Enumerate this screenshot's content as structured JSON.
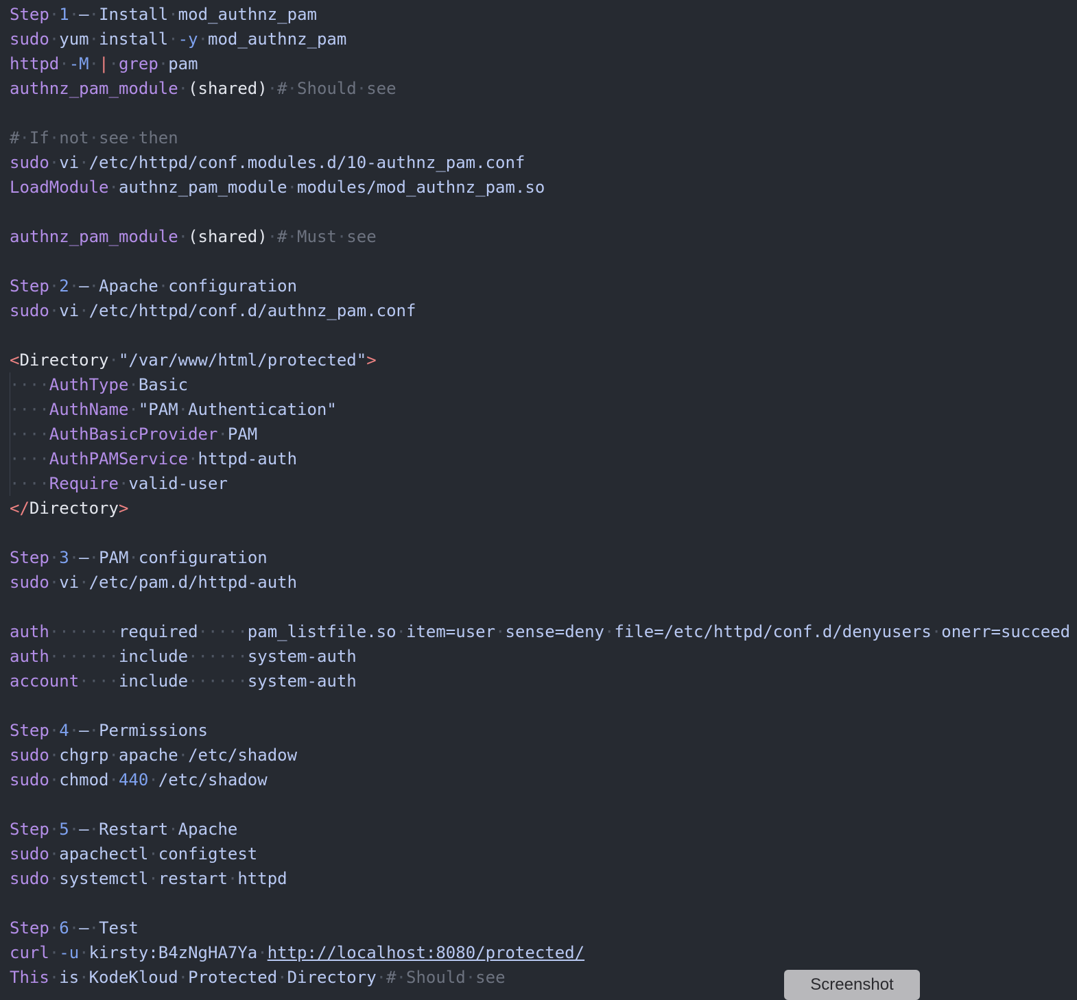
{
  "lines": [
    [
      {
        "c": "k",
        "t": "Step"
      },
      {
        "c": "ws",
        "t": "·"
      },
      {
        "c": "n",
        "t": "1"
      },
      {
        "c": "ws",
        "t": "·"
      },
      {
        "c": "p",
        "t": "—"
      },
      {
        "c": "ws",
        "t": "·"
      },
      {
        "c": "p",
        "t": "Install"
      },
      {
        "c": "ws",
        "t": "·"
      },
      {
        "c": "p",
        "t": "mod_authnz_pam"
      }
    ],
    [
      {
        "c": "k",
        "t": "sudo"
      },
      {
        "c": "ws",
        "t": "·"
      },
      {
        "c": "p",
        "t": "yum"
      },
      {
        "c": "ws",
        "t": "·"
      },
      {
        "c": "p",
        "t": "install"
      },
      {
        "c": "ws",
        "t": "·"
      },
      {
        "c": "n",
        "t": "-y"
      },
      {
        "c": "ws",
        "t": "·"
      },
      {
        "c": "p",
        "t": "mod_authnz_pam"
      }
    ],
    [
      {
        "c": "k",
        "t": "httpd"
      },
      {
        "c": "ws",
        "t": "·"
      },
      {
        "c": "n",
        "t": "-M"
      },
      {
        "c": "ws",
        "t": "·"
      },
      {
        "c": "t",
        "t": "|"
      },
      {
        "c": "ws",
        "t": "·"
      },
      {
        "c": "k",
        "t": "grep"
      },
      {
        "c": "ws",
        "t": "·"
      },
      {
        "c": "p",
        "t": "pam"
      }
    ],
    [
      {
        "c": "k",
        "t": "authnz_pam_module"
      },
      {
        "c": "ws",
        "t": "·"
      },
      {
        "c": "w",
        "t": "(shared)"
      },
      {
        "c": "ws",
        "t": "·"
      },
      {
        "c": "c",
        "t": "#"
      },
      {
        "c": "ws",
        "t": "·"
      },
      {
        "c": "c",
        "t": "Should"
      },
      {
        "c": "ws",
        "t": "·"
      },
      {
        "c": "c",
        "t": "see"
      }
    ],
    [],
    [
      {
        "c": "c",
        "t": "#"
      },
      {
        "c": "ws",
        "t": "·"
      },
      {
        "c": "c",
        "t": "If"
      },
      {
        "c": "ws",
        "t": "·"
      },
      {
        "c": "c",
        "t": "not"
      },
      {
        "c": "ws",
        "t": "·"
      },
      {
        "c": "c",
        "t": "see"
      },
      {
        "c": "ws",
        "t": "·"
      },
      {
        "c": "c",
        "t": "then"
      }
    ],
    [
      {
        "c": "k",
        "t": "sudo"
      },
      {
        "c": "ws",
        "t": "·"
      },
      {
        "c": "p",
        "t": "vi"
      },
      {
        "c": "ws",
        "t": "·"
      },
      {
        "c": "p",
        "t": "/etc/httpd/conf.modules.d/10-authnz_pam.conf"
      }
    ],
    [
      {
        "c": "k",
        "t": "LoadModule"
      },
      {
        "c": "ws",
        "t": "·"
      },
      {
        "c": "p",
        "t": "authnz_pam_module"
      },
      {
        "c": "ws",
        "t": "·"
      },
      {
        "c": "p",
        "t": "modules/mod_authnz_pam.so"
      }
    ],
    [],
    [
      {
        "c": "k",
        "t": "authnz_pam_module"
      },
      {
        "c": "ws",
        "t": "·"
      },
      {
        "c": "w",
        "t": "(shared)"
      },
      {
        "c": "ws",
        "t": "·"
      },
      {
        "c": "c",
        "t": "#"
      },
      {
        "c": "ws",
        "t": "·"
      },
      {
        "c": "c",
        "t": "Must"
      },
      {
        "c": "ws",
        "t": "·"
      },
      {
        "c": "c",
        "t": "see"
      }
    ],
    [],
    [
      {
        "c": "k",
        "t": "Step"
      },
      {
        "c": "ws",
        "t": "·"
      },
      {
        "c": "n",
        "t": "2"
      },
      {
        "c": "ws",
        "t": "·"
      },
      {
        "c": "p",
        "t": "—"
      },
      {
        "c": "ws",
        "t": "·"
      },
      {
        "c": "p",
        "t": "Apache"
      },
      {
        "c": "ws",
        "t": "·"
      },
      {
        "c": "p",
        "t": "configuration"
      }
    ],
    [
      {
        "c": "k",
        "t": "sudo"
      },
      {
        "c": "ws",
        "t": "·"
      },
      {
        "c": "p",
        "t": "vi"
      },
      {
        "c": "ws",
        "t": "·"
      },
      {
        "c": "p",
        "t": "/etc/httpd/conf.d/authnz_pam.conf"
      }
    ],
    [],
    [
      {
        "c": "t",
        "t": "<"
      },
      {
        "c": "w",
        "t": "Directory"
      },
      {
        "c": "ws",
        "t": "·"
      },
      {
        "c": "p",
        "t": "\"/var/www/html/protected\""
      },
      {
        "c": "t",
        "t": ">"
      }
    ],
    [
      {
        "c": "ws",
        "t": "····"
      },
      {
        "c": "k",
        "t": "AuthType"
      },
      {
        "c": "ws",
        "t": "·"
      },
      {
        "c": "p",
        "t": "Basic"
      }
    ],
    [
      {
        "c": "ws",
        "t": "····"
      },
      {
        "c": "k",
        "t": "AuthName"
      },
      {
        "c": "ws",
        "t": "·"
      },
      {
        "c": "p",
        "t": "\"PAM"
      },
      {
        "c": "ws",
        "t": "·"
      },
      {
        "c": "p",
        "t": "Authentication\""
      }
    ],
    [
      {
        "c": "ws",
        "t": "····"
      },
      {
        "c": "k",
        "t": "AuthBasicProvider"
      },
      {
        "c": "ws",
        "t": "·"
      },
      {
        "c": "p",
        "t": "PAM"
      }
    ],
    [
      {
        "c": "ws",
        "t": "····"
      },
      {
        "c": "k",
        "t": "AuthPAMService"
      },
      {
        "c": "ws",
        "t": "·"
      },
      {
        "c": "p",
        "t": "httpd-auth"
      }
    ],
    [
      {
        "c": "ws",
        "t": "····"
      },
      {
        "c": "k",
        "t": "Require"
      },
      {
        "c": "ws",
        "t": "·"
      },
      {
        "c": "p",
        "t": "valid-user"
      }
    ],
    [
      {
        "c": "t",
        "t": "</"
      },
      {
        "c": "w",
        "t": "Directory"
      },
      {
        "c": "t",
        "t": ">"
      }
    ],
    [],
    [
      {
        "c": "k",
        "t": "Step"
      },
      {
        "c": "ws",
        "t": "·"
      },
      {
        "c": "n",
        "t": "3"
      },
      {
        "c": "ws",
        "t": "·"
      },
      {
        "c": "p",
        "t": "—"
      },
      {
        "c": "ws",
        "t": "·"
      },
      {
        "c": "p",
        "t": "PAM"
      },
      {
        "c": "ws",
        "t": "·"
      },
      {
        "c": "p",
        "t": "configuration"
      }
    ],
    [
      {
        "c": "k",
        "t": "sudo"
      },
      {
        "c": "ws",
        "t": "·"
      },
      {
        "c": "p",
        "t": "vi"
      },
      {
        "c": "ws",
        "t": "·"
      },
      {
        "c": "p",
        "t": "/etc/pam.d/httpd-auth"
      }
    ],
    [],
    [
      {
        "c": "k",
        "t": "auth"
      },
      {
        "c": "ws",
        "t": "·······"
      },
      {
        "c": "p",
        "t": "required"
      },
      {
        "c": "ws",
        "t": "·····"
      },
      {
        "c": "p",
        "t": "pam_listfile.so"
      },
      {
        "c": "ws",
        "t": "·"
      },
      {
        "c": "p",
        "t": "item=user"
      },
      {
        "c": "ws",
        "t": "·"
      },
      {
        "c": "p",
        "t": "sense=deny"
      },
      {
        "c": "ws",
        "t": "·"
      },
      {
        "c": "p",
        "t": "file=/etc/httpd/conf.d/denyusers"
      },
      {
        "c": "ws",
        "t": "·"
      },
      {
        "c": "p",
        "t": "onerr=succeed"
      }
    ],
    [
      {
        "c": "k",
        "t": "auth"
      },
      {
        "c": "ws",
        "t": "·······"
      },
      {
        "c": "p",
        "t": "include"
      },
      {
        "c": "ws",
        "t": "······"
      },
      {
        "c": "p",
        "t": "system-auth"
      }
    ],
    [
      {
        "c": "k",
        "t": "account"
      },
      {
        "c": "ws",
        "t": "····"
      },
      {
        "c": "p",
        "t": "include"
      },
      {
        "c": "ws",
        "t": "······"
      },
      {
        "c": "p",
        "t": "system-auth"
      }
    ],
    [],
    [
      {
        "c": "k",
        "t": "Step"
      },
      {
        "c": "ws",
        "t": "·"
      },
      {
        "c": "n",
        "t": "4"
      },
      {
        "c": "ws",
        "t": "·"
      },
      {
        "c": "p",
        "t": "—"
      },
      {
        "c": "ws",
        "t": "·"
      },
      {
        "c": "p",
        "t": "Permissions"
      }
    ],
    [
      {
        "c": "k",
        "t": "sudo"
      },
      {
        "c": "ws",
        "t": "·"
      },
      {
        "c": "p",
        "t": "chgrp"
      },
      {
        "c": "ws",
        "t": "·"
      },
      {
        "c": "p",
        "t": "apache"
      },
      {
        "c": "ws",
        "t": "·"
      },
      {
        "c": "p",
        "t": "/etc/shadow"
      }
    ],
    [
      {
        "c": "k",
        "t": "sudo"
      },
      {
        "c": "ws",
        "t": "·"
      },
      {
        "c": "p",
        "t": "chmod"
      },
      {
        "c": "ws",
        "t": "·"
      },
      {
        "c": "n",
        "t": "440"
      },
      {
        "c": "ws",
        "t": "·"
      },
      {
        "c": "p",
        "t": "/etc/shadow"
      }
    ],
    [],
    [
      {
        "c": "k",
        "t": "Step"
      },
      {
        "c": "ws",
        "t": "·"
      },
      {
        "c": "n",
        "t": "5"
      },
      {
        "c": "ws",
        "t": "·"
      },
      {
        "c": "p",
        "t": "—"
      },
      {
        "c": "ws",
        "t": "·"
      },
      {
        "c": "p",
        "t": "Restart"
      },
      {
        "c": "ws",
        "t": "·"
      },
      {
        "c": "p",
        "t": "Apache"
      }
    ],
    [
      {
        "c": "k",
        "t": "sudo"
      },
      {
        "c": "ws",
        "t": "·"
      },
      {
        "c": "p",
        "t": "apachectl"
      },
      {
        "c": "ws",
        "t": "·"
      },
      {
        "c": "p",
        "t": "configtest"
      }
    ],
    [
      {
        "c": "k",
        "t": "sudo"
      },
      {
        "c": "ws",
        "t": "·"
      },
      {
        "c": "p",
        "t": "systemctl"
      },
      {
        "c": "ws",
        "t": "·"
      },
      {
        "c": "p",
        "t": "restart"
      },
      {
        "c": "ws",
        "t": "·"
      },
      {
        "c": "p",
        "t": "httpd"
      }
    ],
    [],
    [
      {
        "c": "k",
        "t": "Step"
      },
      {
        "c": "ws",
        "t": "·"
      },
      {
        "c": "n",
        "t": "6"
      },
      {
        "c": "ws",
        "t": "·"
      },
      {
        "c": "p",
        "t": "—"
      },
      {
        "c": "ws",
        "t": "·"
      },
      {
        "c": "p",
        "t": "Test"
      }
    ],
    [
      {
        "c": "k",
        "t": "curl"
      },
      {
        "c": "ws",
        "t": "·"
      },
      {
        "c": "n",
        "t": "-u"
      },
      {
        "c": "ws",
        "t": "·"
      },
      {
        "c": "p",
        "t": "kirsty:B4zNgHA7Ya"
      },
      {
        "c": "ws",
        "t": "·"
      },
      {
        "c": "u",
        "t": "http://localhost:8080/protected/"
      }
    ],
    [
      {
        "c": "k",
        "t": "This"
      },
      {
        "c": "ws",
        "t": "·"
      },
      {
        "c": "p",
        "t": "is"
      },
      {
        "c": "ws",
        "t": "·"
      },
      {
        "c": "p",
        "t": "KodeKloud"
      },
      {
        "c": "ws",
        "t": "·"
      },
      {
        "c": "p",
        "t": "Protected"
      },
      {
        "c": "ws",
        "t": "·"
      },
      {
        "c": "p",
        "t": "Directory"
      },
      {
        "c": "ws",
        "t": "·"
      },
      {
        "c": "c",
        "t": "#"
      },
      {
        "c": "ws",
        "t": "·"
      },
      {
        "c": "c",
        "t": "Should"
      },
      {
        "c": "ws",
        "t": "·"
      },
      {
        "c": "c",
        "t": "see"
      }
    ]
  ],
  "screenshot_button": {
    "label": "Screenshot"
  },
  "colors": {
    "background": "#262a31",
    "keyword": "#b48ee8",
    "number": "#7fa2f0",
    "text": "#b9c9f3",
    "comment": "#6d7380",
    "tag": "#ef8383",
    "whitespace": "#4f5663"
  }
}
